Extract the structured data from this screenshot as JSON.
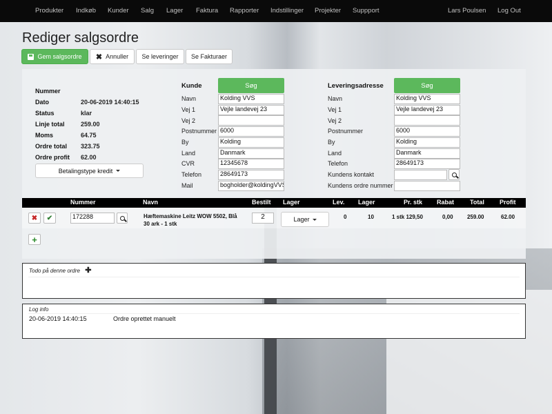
{
  "nav": {
    "items": [
      "Produkter",
      "Indkøb",
      "Kunder",
      "Salg",
      "Lager",
      "Faktura",
      "Rapporter",
      "Indstillinger",
      "Projekter",
      "Suppport"
    ],
    "user": "Lars Poulsen",
    "logout": "Log Out"
  },
  "page": {
    "title": "Rediger salgsordre"
  },
  "toolbar": {
    "save": "Gem salgsordre",
    "cancel": "Annuller",
    "deliveries": "Se leveringer",
    "invoices": "Se Fakturaer"
  },
  "summary": {
    "labels": [
      "Nummer",
      "Dato",
      "Status",
      "Linje total",
      "Moms",
      "Ordre total",
      "Ordre profit"
    ],
    "values": [
      "",
      "20-06-2019 14:40:15",
      "klar",
      "259.00",
      "64.75",
      "323.75",
      "62.00"
    ],
    "payment_button": "Betalingstype kredit"
  },
  "customer": {
    "title": "Kunde",
    "search": "Søg",
    "labels": [
      "Navn",
      "Vej 1",
      "Vej 2",
      "Postnummer",
      "By",
      "Land",
      "CVR",
      "Telefon",
      "Mail"
    ],
    "values": [
      "Kolding VVS",
      "Vejle landevej 23",
      "",
      "6000",
      "Kolding",
      "Danmark",
      "12345678",
      "28649173",
      "bogholder@koldingVVS"
    ]
  },
  "delivery": {
    "title": "Leveringsadresse",
    "search": "Søg",
    "labels": [
      "Navn",
      "Vej 1",
      "Vej 2",
      "Postnummer",
      "By",
      "Land",
      "Telefon",
      "Kundens kontakt",
      "Kundens ordre nummer"
    ],
    "values": [
      "Kolding VVS",
      "Vejle landevej 23",
      "",
      "6000",
      "Kolding",
      "Danmark",
      "28649173",
      "",
      ""
    ]
  },
  "lines": {
    "headers": [
      "Nummer",
      "Navn",
      "Bestilt",
      "Lager",
      "Lev.",
      "Lager",
      "Pr. stk",
      "Rabat",
      "Total",
      "Profit"
    ],
    "row": {
      "number": "172288",
      "name_line1": "Hæftemaskine Leitz WOW 5502, Blå",
      "name_line2": "30 ark - 1 stk",
      "ordered": "2",
      "stock_button": "Lager",
      "delivered": "0",
      "stock": "10",
      "price": "1 stk 129,50",
      "discount": "0,00",
      "total": "259.00",
      "profit": "62.00"
    }
  },
  "todo": {
    "title": "Todo på denne ordre"
  },
  "log": {
    "title": "Log info",
    "date": "20-06-2019 14:40:15",
    "message": "Ordre oprettet manuelt"
  }
}
